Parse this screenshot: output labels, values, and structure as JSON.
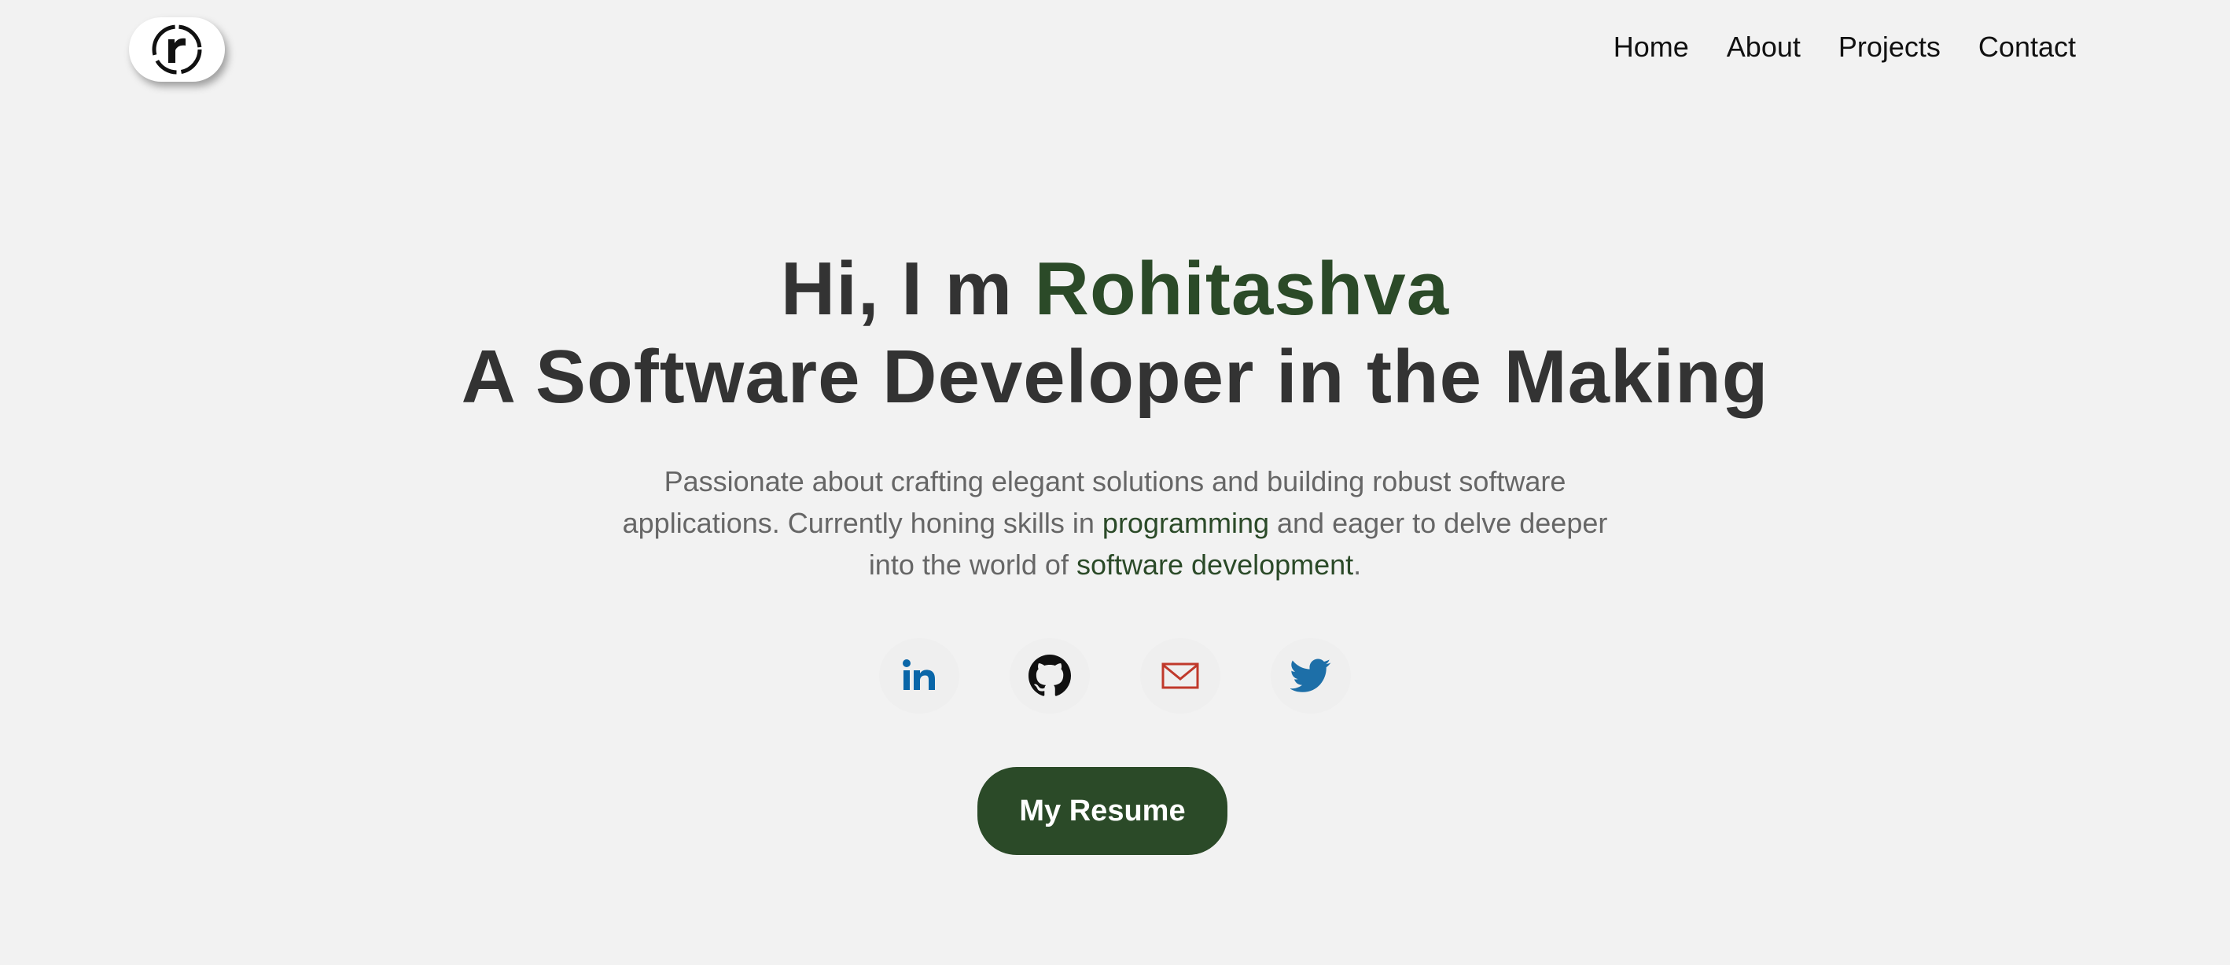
{
  "header": {
    "logo_icon": "r-logo-icon",
    "nav": [
      {
        "label": "Home"
      },
      {
        "label": "About"
      },
      {
        "label": "Projects"
      },
      {
        "label": "Contact"
      }
    ]
  },
  "hero": {
    "greeting_prefix": "Hi, I m ",
    "name": "Rohitashva",
    "title_line": "A Software Developer in the Making",
    "tagline": {
      "part1": "Passionate about crafting elegant solutions and building robust software applications. Currently honing skills in ",
      "highlight1": "programming",
      "part2": " and eager to delve deeper into the world of ",
      "highlight2": "software development",
      "part3": "."
    }
  },
  "socials": [
    {
      "icon": "linkedin-icon",
      "color": "#0a66a8"
    },
    {
      "icon": "github-icon",
      "color": "#111111"
    },
    {
      "icon": "mail-icon",
      "color": "#c0392b"
    },
    {
      "icon": "twitter-icon",
      "color": "#1d6fa8"
    }
  ],
  "cta": {
    "resume_label": "My Resume"
  },
  "colors": {
    "accent": "#2b4a28",
    "background": "#f2f2f2",
    "heading": "#333333",
    "body_text": "#666666"
  }
}
